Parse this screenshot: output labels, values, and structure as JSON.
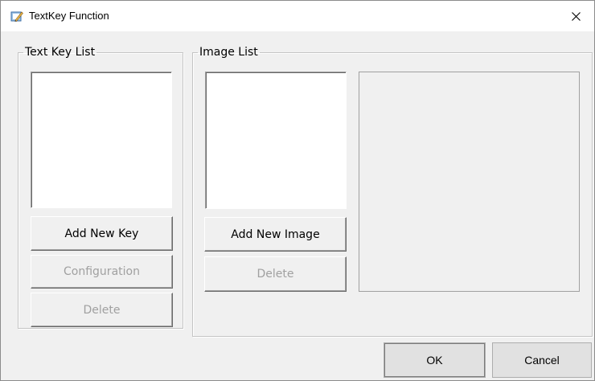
{
  "window": {
    "title": "TextKey Function",
    "icon": "textkey-app-icon"
  },
  "text_key_group": {
    "legend": "Text Key List",
    "items": [],
    "add_label": "Add New Key",
    "config_label": "Configuration",
    "delete_label": "Delete"
  },
  "image_group": {
    "legend": "Image List",
    "items": [],
    "add_label": "Add New Image",
    "delete_label": "Delete"
  },
  "footer": {
    "ok_label": "OK",
    "cancel_label": "Cancel"
  }
}
